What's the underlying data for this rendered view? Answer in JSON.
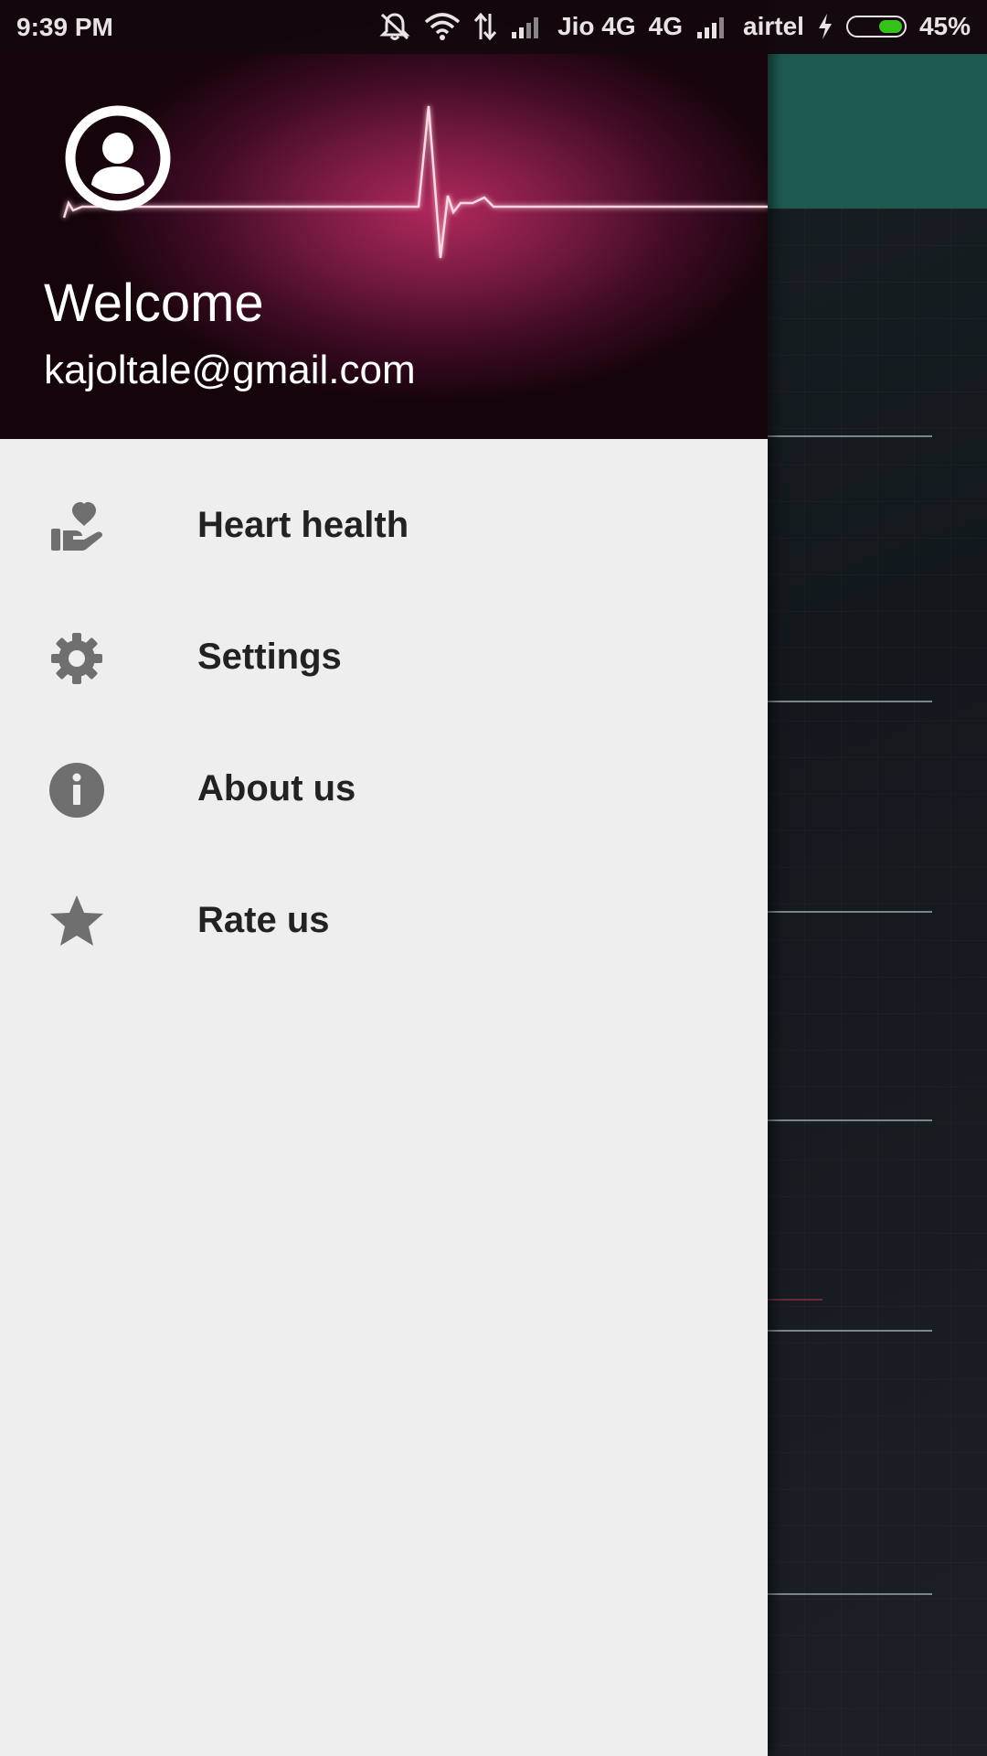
{
  "status_bar": {
    "time": "9:39 PM",
    "carrier1": "Jio 4G",
    "network_type": "4G",
    "carrier2": "airtel",
    "battery_percent_label": "45%",
    "battery_level": 0.45,
    "icons": [
      "mute-bell-icon",
      "wifi-icon",
      "data-arrows-icon",
      "signal-icon",
      "signal-icon",
      "charging-bolt-icon",
      "battery-icon"
    ]
  },
  "drawer": {
    "header": {
      "title": "Welcome",
      "email": "kajoltale@gmail.com",
      "avatar_icon": "account-circle-icon"
    },
    "items": [
      {
        "label": "Heart health",
        "icon": "heart-hand-icon"
      },
      {
        "label": "Settings",
        "icon": "gear-icon"
      },
      {
        "label": "About us",
        "icon": "info-icon"
      },
      {
        "label": "Rate us",
        "icon": "star-icon"
      }
    ]
  },
  "colors": {
    "toolbar": "#1f5a50",
    "drawer_bg": "#eeeeee",
    "header_accent": "#b0285a",
    "icon_gray": "#6f6f6f",
    "battery_fill": "#35c21a"
  }
}
